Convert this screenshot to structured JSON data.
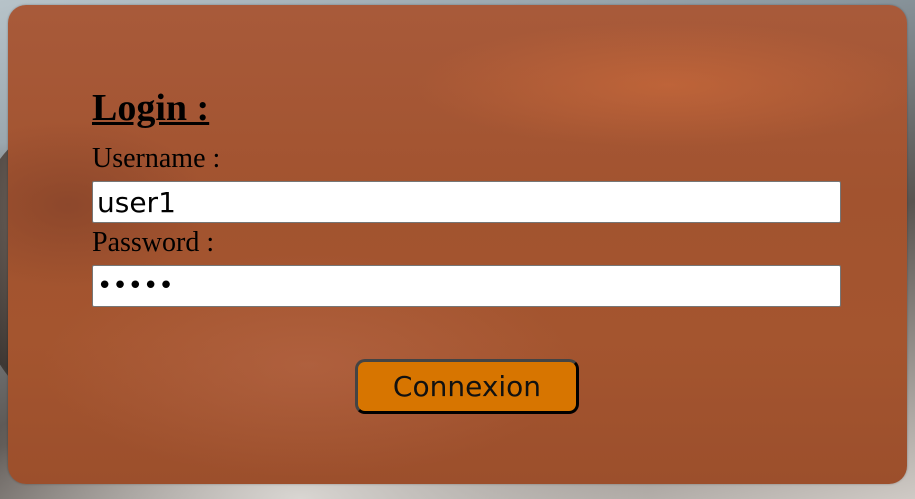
{
  "login": {
    "title": "Login :",
    "username_label": "Username :",
    "username_value": "user1",
    "password_label": "Password :",
    "password_value": "•••••",
    "submit_label": "Connexion"
  },
  "colors": {
    "panel": "#a4552f",
    "button": "#d77500",
    "input_background": "#ffffff",
    "text": "#000000"
  }
}
